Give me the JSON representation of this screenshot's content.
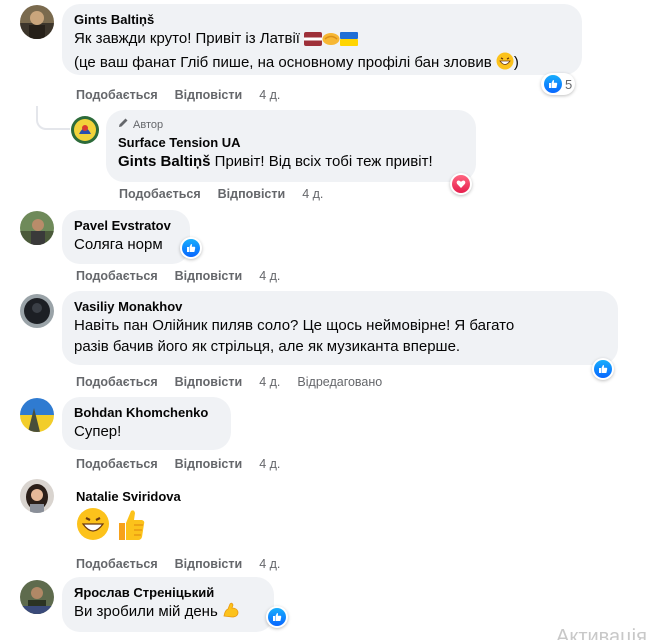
{
  "comments": [
    {
      "name": "Gints Baltiņš",
      "lines": [
        "Як завжди круто! Привіт із Латвії",
        "(це ваш фанат Гліб пише, на основному профілі бан зловив"
      ],
      "like": "Подобається",
      "reply": "Відповісти",
      "time": "4 д.",
      "reaction_count": "5"
    },
    {
      "author_badge": "Автор",
      "name": "Surface Tension UA",
      "mention": "Gints Baltiņš",
      "text": " Привіт! Від всіх тобі теж привіт!",
      "like": "Подобається",
      "reply": "Відповісти",
      "time": "4 д."
    },
    {
      "name": "Pavel Evstratov",
      "text": "Соляга норм",
      "like": "Подобається",
      "reply": "Відповісти",
      "time": "4 д."
    },
    {
      "name": "Vasiliy Monakhov",
      "lines": [
        "Навіть пан Олійник пиляв соло? Це щось неймовірне! Я багато",
        "разів бачив його як стрільця, але як музиканта вперше."
      ],
      "like": "Подобається",
      "reply": "Відповісти",
      "time": "4 д.",
      "edited": "Відредаговано"
    },
    {
      "name": "Bohdan Khomchenko",
      "text": "Супер!",
      "like": "Подобається",
      "reply": "Відповісти",
      "time": "4 д."
    },
    {
      "name": "Natalie Sviridova",
      "like": "Подобається",
      "reply": "Відповісти",
      "time": "4 д."
    },
    {
      "name": "Ярослав Стреніцький",
      "text": "Ви зробили мій день"
    }
  ],
  "watermark": "Активація",
  "colors": {
    "bubble": "#f0f2f5",
    "meta": "#65676b",
    "like_blue": "#0866ff",
    "love_red": "#e61e4d"
  }
}
